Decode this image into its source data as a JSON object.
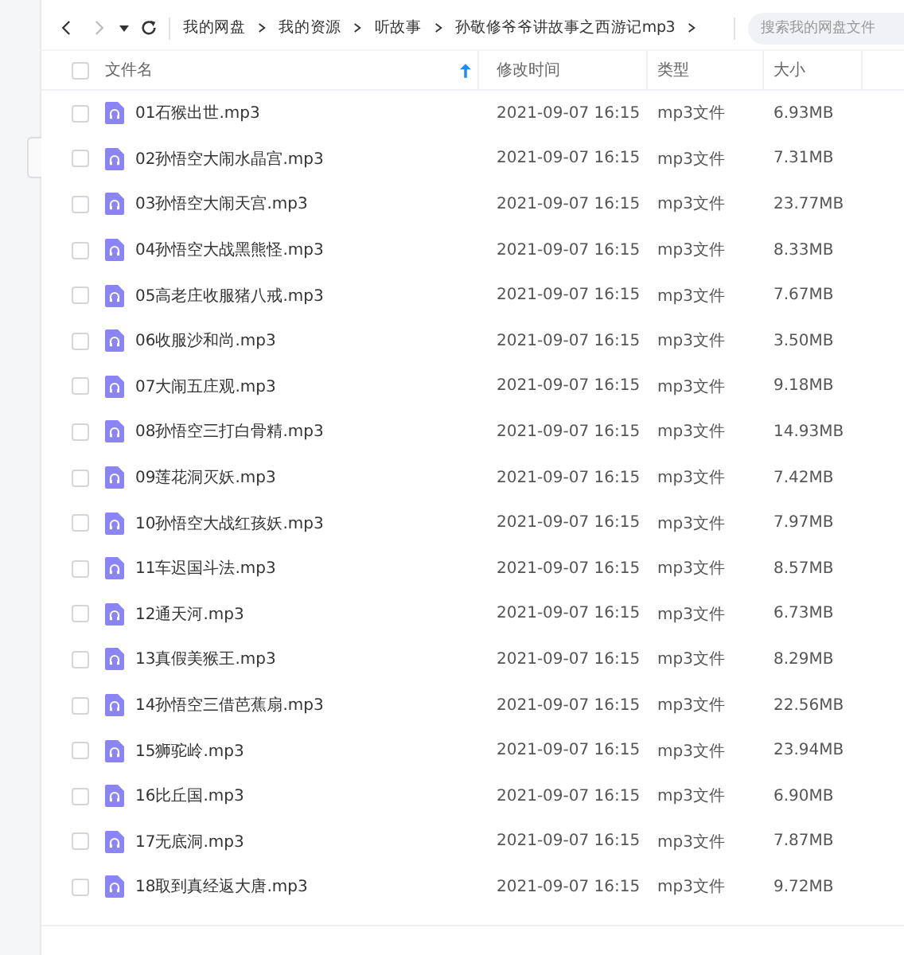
{
  "toolbar": {
    "back_disabled": false,
    "forward_disabled": true,
    "breadcrumbs": [
      "我的网盘",
      "我的资源",
      "听故事",
      "孙敬修爷爷讲故事之西游记mp3"
    ],
    "search": {
      "placeholder": "搜索我的网盘文件"
    }
  },
  "table": {
    "select_all_checked": false,
    "columns": [
      {
        "label": "文件名",
        "sorted": true
      },
      {
        "label": "修改时间",
        "sorted": false
      },
      {
        "label": "类型",
        "sorted": false
      },
      {
        "label": "大小",
        "sorted": false
      }
    ],
    "rows": [
      {
        "checked": false,
        "name": "01石猴出世.mp3",
        "modified": "2021-09-07 16:15",
        "type": "mp3文件",
        "size": "6.93MB"
      },
      {
        "checked": false,
        "name": "02孙悟空大闹水晶宫.mp3",
        "modified": "2021-09-07 16:15",
        "type": "mp3文件",
        "size": "7.31MB"
      },
      {
        "checked": false,
        "name": "03孙悟空大闹天宫.mp3",
        "modified": "2021-09-07 16:15",
        "type": "mp3文件",
        "size": "23.77MB"
      },
      {
        "checked": false,
        "name": "04孙悟空大战黑熊怪.mp3",
        "modified": "2021-09-07 16:15",
        "type": "mp3文件",
        "size": "8.33MB"
      },
      {
        "checked": false,
        "name": "05高老庄收服猪八戒.mp3",
        "modified": "2021-09-07 16:15",
        "type": "mp3文件",
        "size": "7.67MB"
      },
      {
        "checked": false,
        "name": "06收服沙和尚.mp3",
        "modified": "2021-09-07 16:15",
        "type": "mp3文件",
        "size": "3.50MB"
      },
      {
        "checked": false,
        "name": "07大闹五庄观.mp3",
        "modified": "2021-09-07 16:15",
        "type": "mp3文件",
        "size": "9.18MB"
      },
      {
        "checked": false,
        "name": "08孙悟空三打白骨精.mp3",
        "modified": "2021-09-07 16:15",
        "type": "mp3文件",
        "size": "14.93MB"
      },
      {
        "checked": false,
        "name": "09莲花洞灭妖.mp3",
        "modified": "2021-09-07 16:15",
        "type": "mp3文件",
        "size": "7.42MB"
      },
      {
        "checked": false,
        "name": "10孙悟空大战红孩妖.mp3",
        "modified": "2021-09-07 16:15",
        "type": "mp3文件",
        "size": "7.97MB"
      },
      {
        "checked": false,
        "name": "11车迟国斗法.mp3",
        "modified": "2021-09-07 16:15",
        "type": "mp3文件",
        "size": "8.57MB"
      },
      {
        "checked": false,
        "name": "12通天河.mp3",
        "modified": "2021-09-07 16:15",
        "type": "mp3文件",
        "size": "6.73MB"
      },
      {
        "checked": false,
        "name": "13真假美猴王.mp3",
        "modified": "2021-09-07 16:15",
        "type": "mp3文件",
        "size": "8.29MB"
      },
      {
        "checked": false,
        "name": "14孙悟空三借芭蕉扇.mp3",
        "modified": "2021-09-07 16:15",
        "type": "mp3文件",
        "size": "22.56MB"
      },
      {
        "checked": false,
        "name": "15狮驼岭.mp3",
        "modified": "2021-09-07 16:15",
        "type": "mp3文件",
        "size": "23.94MB"
      },
      {
        "checked": false,
        "name": "16比丘国.mp3",
        "modified": "2021-09-07 16:15",
        "type": "mp3文件",
        "size": "6.90MB"
      },
      {
        "checked": false,
        "name": "17无底洞.mp3",
        "modified": "2021-09-07 16:15",
        "type": "mp3文件",
        "size": "7.87MB"
      },
      {
        "checked": false,
        "name": "18取到真经返大唐.mp3",
        "modified": "2021-09-07 16:15",
        "type": "mp3文件",
        "size": "9.72MB"
      }
    ]
  }
}
